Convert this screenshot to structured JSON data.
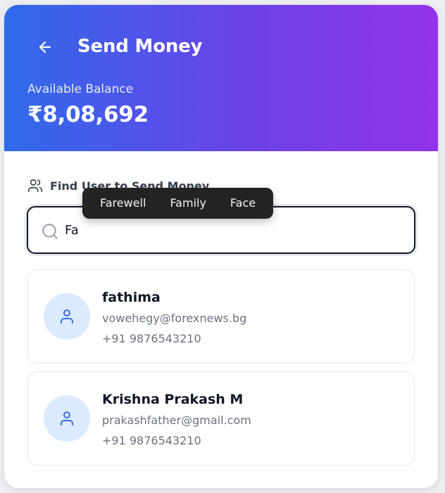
{
  "header": {
    "title": "Send Money",
    "balance_label": "Available Balance",
    "balance_amount": "₹8,08,692"
  },
  "search": {
    "section_label": "Find User to Send Money",
    "value": "Fa"
  },
  "suggestions": [
    "Farewell",
    "Family",
    "Face"
  ],
  "users": [
    {
      "name": "fathima",
      "email": "vowehegy@forexnews.bg",
      "phone": "+91 9876543210"
    },
    {
      "name": "Krishna Prakash M",
      "email": "prakashfather@gmail.com",
      "phone": "+91 9876543210"
    }
  ],
  "colors": {
    "gradient_start": "#2f6bea",
    "gradient_end": "#9333ea",
    "avatar_bg": "#dbeafe",
    "avatar_icon": "#3b6fd6"
  },
  "icons": {
    "back": "arrow-left-icon",
    "users": "users-icon",
    "search": "search-icon",
    "user": "user-icon"
  }
}
